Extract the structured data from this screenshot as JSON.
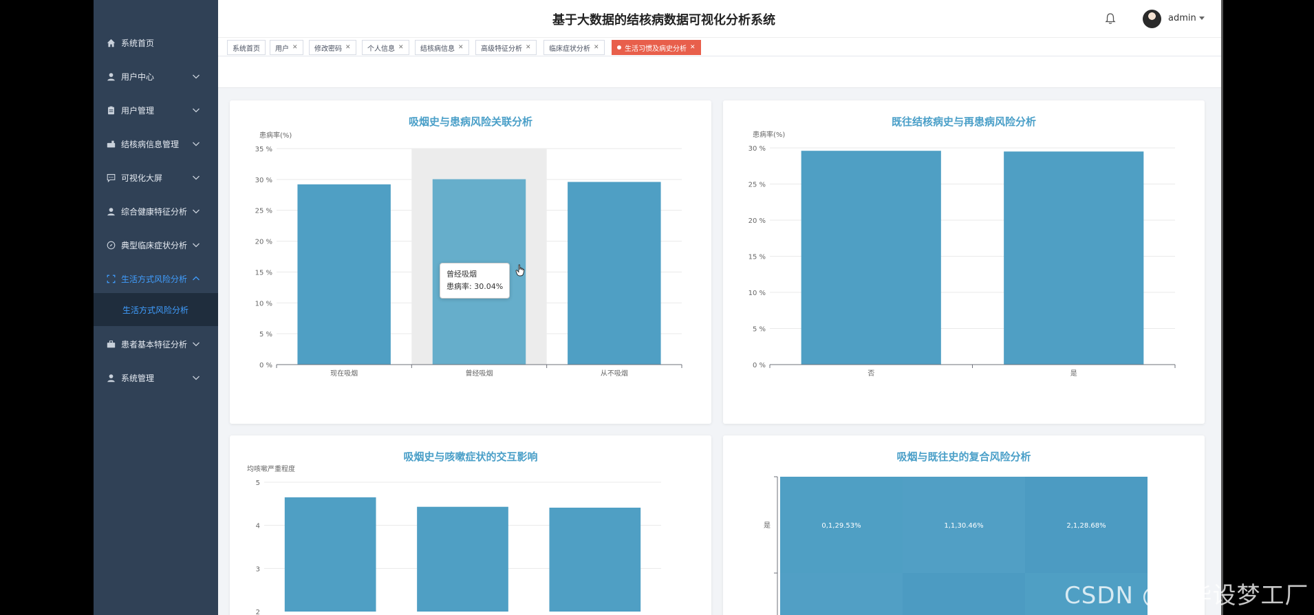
{
  "sidebar": {
    "items": [
      {
        "label": "系统首页",
        "icon": "home-icon"
      },
      {
        "label": "用户中心",
        "icon": "user-icon"
      },
      {
        "label": "用户管理",
        "icon": "clipboard-icon"
      },
      {
        "label": "结核病信息管理",
        "icon": "briefcase-icon"
      },
      {
        "label": "可视化大屏",
        "icon": "message-icon"
      },
      {
        "label": "综合健康特征分析",
        "icon": "user-icon"
      },
      {
        "label": "典型临床症状分析",
        "icon": "compass-icon"
      },
      {
        "label": "生活方式风险分析",
        "icon": "fullscreen-icon"
      },
      {
        "label": "患者基本特征分析",
        "icon": "suitcase-icon"
      },
      {
        "label": "系统管理",
        "icon": "user-icon"
      }
    ],
    "active_sub": "生活方式风险分析",
    "active_color": "#409eff",
    "bg_color": "#304156"
  },
  "header": {
    "title": "基于大数据的结核病数据可视化分析系统",
    "username": "admin"
  },
  "tags": [
    {
      "label": "系统首页",
      "closable": false
    },
    {
      "label": "用户",
      "closable": true
    },
    {
      "label": "修改密码",
      "closable": true
    },
    {
      "label": "个人信息",
      "closable": true
    },
    {
      "label": "结核病信息",
      "closable": true
    },
    {
      "label": "高级特征分析",
      "closable": true
    },
    {
      "label": "临床症状分析",
      "closable": true
    },
    {
      "label": "生活习惯及病史分析",
      "closable": true,
      "active": true
    }
  ],
  "tag_active_color": "#e85f4b",
  "charts": {
    "bar_color": "#4f9fc4",
    "highlight_color": "#66aecb",
    "smoking": {
      "title": "吸烟史与患病风险关联分析",
      "ylabel": "患病率(%)",
      "tick_labels": [
        "0 %",
        "5 %",
        "10 %",
        "15 %",
        "20 %",
        "25 %",
        "30 %",
        "35 %"
      ]
    },
    "history": {
      "title": "既往结核病史与再患病风险分析",
      "ylabel": "患病率(%)",
      "tick_labels": [
        "0 %",
        "5 %",
        "10 %",
        "15 %",
        "20 %",
        "25 %",
        "30 %"
      ]
    },
    "cough": {
      "title": "吸烟史与咳嗽症状的交互影响",
      "ylabel": "均咳嗽严重程度",
      "tick_labels": [
        "2",
        "3",
        "4",
        "5"
      ]
    },
    "combo": {
      "title": "吸烟与既往史的复合风险分析",
      "row_label": "是",
      "cells": [
        "0,1,29.53%",
        "1,1,30.46%",
        "2,1,28.68%"
      ]
    }
  },
  "tooltip": {
    "title": "曾经吸烟",
    "line": "患病率: 30.04%"
  },
  "chart_data": [
    {
      "type": "bar",
      "title": "吸烟史与患病风险关联分析",
      "ylabel": "患病率(%)",
      "categories": [
        "现在吸烟",
        "曾经吸烟",
        "从不吸烟"
      ],
      "values": [
        29.2,
        30.04,
        29.6
      ],
      "ylim": [
        0,
        35
      ],
      "grid": true
    },
    {
      "type": "bar",
      "title": "既往结核病史与再患病风险分析",
      "ylabel": "患病率(%)",
      "categories": [
        "否",
        "是"
      ],
      "values": [
        29.6,
        29.5
      ],
      "ylim": [
        0,
        30
      ],
      "grid": true
    },
    {
      "type": "bar",
      "title": "吸烟史与咳嗽症状的交互影响",
      "ylabel": "均咳嗽严重程度",
      "categories": [
        "",
        "",
        ""
      ],
      "values": [
        4.65,
        4.43,
        4.41
      ],
      "ylim": [
        2,
        5
      ],
      "grid": true
    },
    {
      "type": "heatmap",
      "title": "吸烟与既往史的复合风险分析",
      "rows": [
        "是"
      ],
      "cells": [
        "0,1,29.53%",
        "1,1,30.46%",
        "2,1,28.68%"
      ]
    }
  ],
  "watermark": "CSDN @IT毕设梦工厂"
}
